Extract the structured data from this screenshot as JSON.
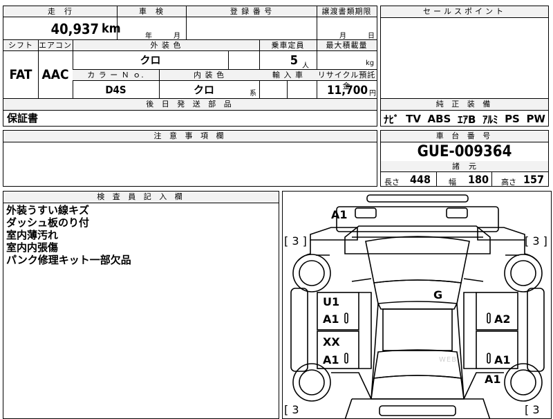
{
  "top": {
    "mileage_label": "走　行",
    "mileage_value": "40,937",
    "mileage_unit": "km",
    "inspection_label": "車　検",
    "inspection_year": "年",
    "inspection_month": "月",
    "registration_label": "登 録 番 号",
    "transfer_label": "譲渡書類期限",
    "transfer_month": "月",
    "transfer_day": "日",
    "shift_label": "シフト",
    "shift_value": "FAT",
    "ac_label": "エアコン",
    "ac_value": "AAC",
    "exterior_label": "外 装 色",
    "exterior_value": "クロ",
    "capacity_label": "乗車定員",
    "capacity_value": "5",
    "capacity_unit": "人",
    "load_label": "最大積載量",
    "load_unit": "kg",
    "color_no_label": "カ ラ ー Ｎ ｏ.",
    "color_no_value": "D4S",
    "interior_label": "内 装 色",
    "interior_value": "クロ",
    "interior_unit": "系",
    "import_label": "輸 入 車",
    "recycle_label": "リサイクル預託金",
    "recycle_value": "11,700",
    "recycle_unit": "円",
    "later_label": "後 日 発 送 部 品",
    "later_value": "保証書",
    "notes_label": "注 意 事 項 欄"
  },
  "right": {
    "sales_label": "セールスポイント",
    "equipment_label": "純 正 装 備",
    "equipment": [
      "ﾅﾋﾞ",
      "TV",
      "ABS",
      "ｴｱB",
      "ｱﾙﾐ",
      "PS",
      "PW"
    ],
    "chassis_label": "車 台 番 号",
    "chassis_value": "GUE-009364",
    "specs_label": "諸　元",
    "length_label": "長さ",
    "length_value": "448",
    "width_label": "幅",
    "width_value": "180",
    "height_label": "高さ",
    "height_value": "157"
  },
  "inspector": {
    "label": "検 査 員 記 入 欄",
    "lines": [
      "外装うすい線キズ",
      "ダッシュ板のり付",
      "室内薄汚れ",
      "室内内張傷",
      "パンク修理キット一部欠品"
    ]
  },
  "diagram": {
    "marks": {
      "front_top": "A1",
      "bracket_tl": "[ 3 ]",
      "bracket_tr": "[ 3 ]",
      "bracket_bl": "[ 3",
      "bracket_br": "[ 3",
      "roof": "G",
      "left_door_u": "U1",
      "left_door_a": "A1",
      "left_rear_x": "XX",
      "left_rear_a": "A1",
      "right_door": "A2",
      "right_rear": "A1",
      "right_quarter": "A1"
    },
    "watermark": "WEB"
  }
}
